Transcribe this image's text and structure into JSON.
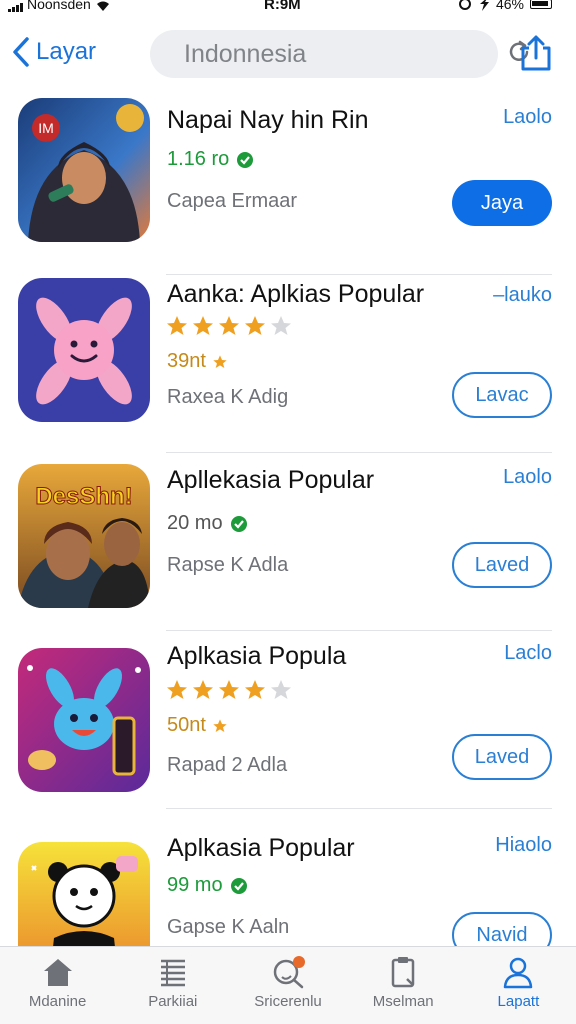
{
  "status_bar": {
    "carrier": "Noonsden",
    "time": "R:9M",
    "battery": "46%"
  },
  "nav": {
    "back_label": "Layar",
    "search_placeholder": "Indonnesia"
  },
  "apps": [
    {
      "title": "Napai Nay hin Rin",
      "meta": "1.16 ro",
      "subtitle": "Capea  Ermaar",
      "corner": "Laolo",
      "action": "Jaya",
      "action_style": "filled",
      "rating": null
    },
    {
      "title": "Aanka: Aplkias Popular",
      "meta": "39nt",
      "subtitle": "Raxea  K  Adig",
      "corner": "–lauko",
      "action": "Lavac",
      "action_style": "outline",
      "rating": 4
    },
    {
      "title": "Apllekasia Popular",
      "meta": "20 mo",
      "subtitle": "Rapse  K  Adla",
      "corner": "Laolo",
      "action": "Laved",
      "action_style": "outline",
      "rating": null,
      "icon_text": "DesShn!"
    },
    {
      "title": "Aplkasia Popula",
      "meta": "50nt",
      "subtitle": "Rapad  2  Adla",
      "corner": "Laclo",
      "action": "Laved",
      "action_style": "outline",
      "rating": 4
    },
    {
      "title": "Aplkasia Popular",
      "meta": "99 mo",
      "subtitle": "Gapse  K  Aaln",
      "corner": "Hiaolo",
      "action": "Navid",
      "action_style": "outline",
      "rating": null
    }
  ],
  "icon_badges": {
    "app1": "IM"
  },
  "tabs": [
    {
      "label": "Mdanine",
      "icon": "home-icon"
    },
    {
      "label": "Parkiiai",
      "icon": "list-icon"
    },
    {
      "label": "Sricerenlu",
      "icon": "search-icon"
    },
    {
      "label": "Mselman",
      "icon": "clipboard-icon"
    },
    {
      "label": "Lapatt",
      "icon": "person-icon"
    }
  ],
  "colors": {
    "accent": "#1a73d9",
    "button_fill": "#0d6ee6",
    "green": "#1d9b3a",
    "star": "#f0a020"
  }
}
